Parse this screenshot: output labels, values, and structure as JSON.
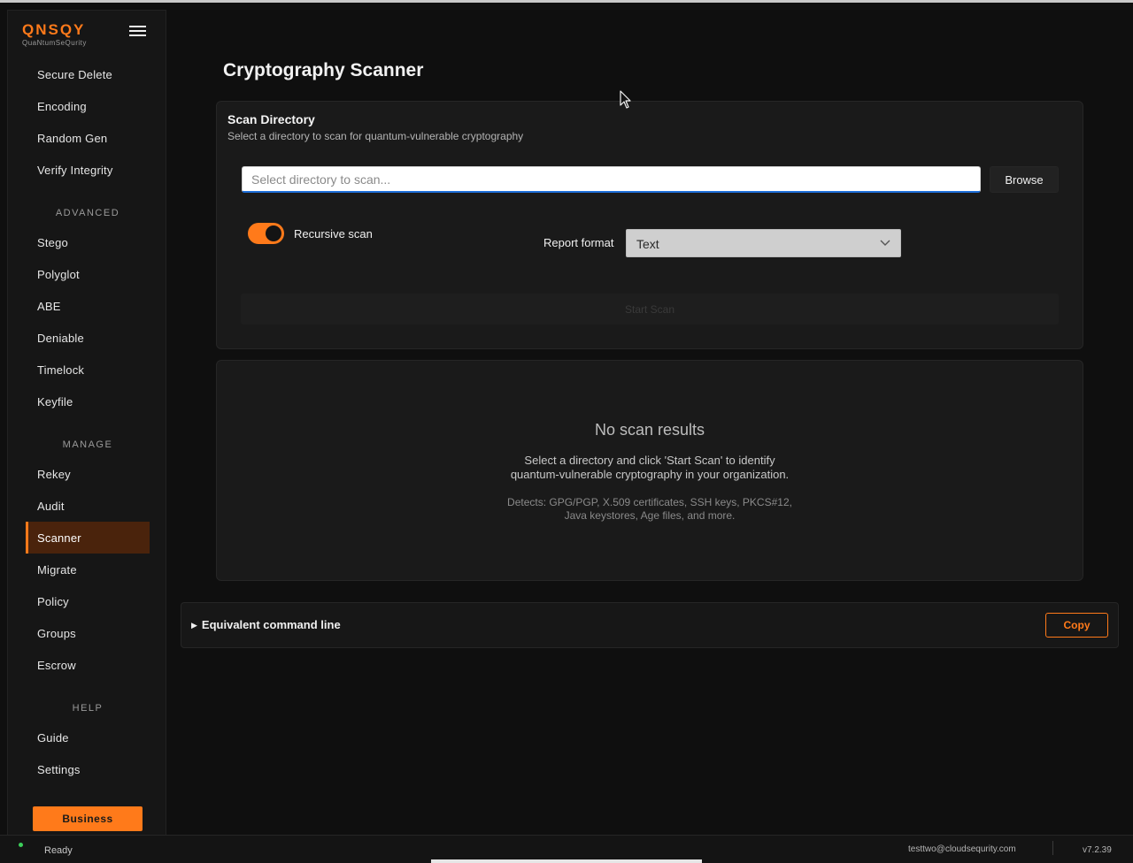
{
  "logo": {
    "main": "QNSQY",
    "sub": "QuaNtumSeQurity"
  },
  "sidebar": {
    "items": [
      {
        "label": "Secure Delete",
        "name": "sidebar-item-secure-delete"
      },
      {
        "label": "Encoding",
        "name": "sidebar-item-encoding"
      },
      {
        "label": "Random Gen",
        "name": "sidebar-item-random-gen"
      },
      {
        "label": "Verify Integrity",
        "name": "sidebar-item-verify-integrity"
      }
    ],
    "advanced_label": "ADVANCED",
    "advanced": [
      {
        "label": "Stego"
      },
      {
        "label": "Polyglot"
      },
      {
        "label": "ABE"
      },
      {
        "label": "Deniable"
      },
      {
        "label": "Timelock"
      },
      {
        "label": "Keyfile"
      }
    ],
    "manage_label": "MANAGE",
    "manage": [
      {
        "label": "Rekey"
      },
      {
        "label": "Audit"
      },
      {
        "label": "Scanner",
        "active": true
      },
      {
        "label": "Migrate"
      },
      {
        "label": "Policy"
      },
      {
        "label": "Groups"
      },
      {
        "label": "Escrow"
      }
    ],
    "help_label": "HELP",
    "help": [
      {
        "label": "Guide"
      },
      {
        "label": "Settings"
      }
    ],
    "business_label": "Business"
  },
  "page": {
    "title": "Cryptography Scanner"
  },
  "scan": {
    "title": "Scan Directory",
    "description": "Select a directory to scan for quantum-vulnerable cryptography",
    "input_value": "",
    "input_placeholder": "Select directory to scan...",
    "browse_label": "Browse",
    "recursive_label": "Recursive scan",
    "recursive_on": true,
    "report_label": "Report format",
    "report_value": "Text",
    "start_label": "Start Scan"
  },
  "results": {
    "title": "No scan results",
    "line1": "Select a directory and click 'Start Scan' to identify",
    "line2": "quantum-vulnerable cryptography in your organization.",
    "detects1": "Detects: GPG/PGP, X.509 certificates, SSH keys, PKCS#12,",
    "detects2": "Java keystores, Age files, and more."
  },
  "cmd": {
    "label": "Equivalent command line",
    "copy_label": "Copy"
  },
  "status": {
    "text": "Ready",
    "email": "testtwo@cloudsequrity.com",
    "version": "v7.2.39"
  },
  "colors": {
    "accent": "#ff7a1a",
    "active_bg": "#4a230c",
    "status_ok": "#3ccf5a"
  }
}
